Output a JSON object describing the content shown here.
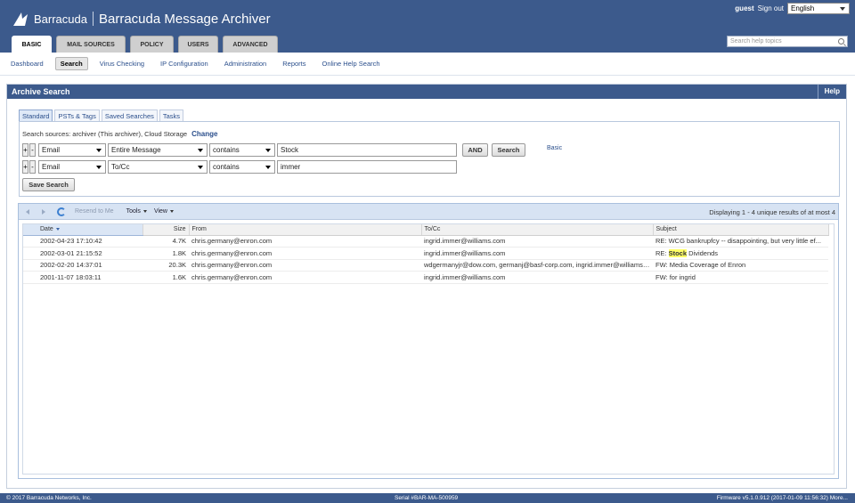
{
  "header": {
    "brand": "Barracuda",
    "app_title": "Barracuda Message Archiver",
    "username": "guest",
    "signout": "Sign out",
    "language": "English",
    "help_search_placeholder": "Search help topics",
    "tabs": [
      "BASIC",
      "MAIL SOURCES",
      "POLICY",
      "USERS",
      "ADVANCED"
    ]
  },
  "subnav": [
    "Dashboard",
    "Search",
    "Virus Checking",
    "IP Configuration",
    "Administration",
    "Reports",
    "Online Help Search"
  ],
  "panel": {
    "title": "Archive Search",
    "help": "Help",
    "search_tabs": [
      "Standard",
      "PSTs & Tags",
      "Saved Searches",
      "Tasks"
    ],
    "sources_text": "Search sources: archiver (This archiver), Cloud Storage",
    "change_link": "Change",
    "criteria": [
      {
        "field": "Email",
        "scope": "Entire Message",
        "op": "contains",
        "value": "Stock"
      },
      {
        "field": "Email",
        "scope": "To/Cc",
        "op": "contains",
        "value": "immer"
      }
    ],
    "and_label": "AND",
    "search_label": "Search",
    "basic_link": "Basic",
    "save_search_label": "Save Search",
    "plus": "+",
    "minus": "-"
  },
  "grid": {
    "toolbar": {
      "resend": "Resend to Me",
      "tools": "Tools",
      "view": "View",
      "display_count": "Displaying 1 - 4 unique results of at most 4"
    },
    "columns": [
      "Date",
      "Size",
      "From",
      "To/Cc",
      "Subject"
    ],
    "rows": [
      {
        "date": "2002-04-23 17:10:42",
        "size": "4.7K",
        "from": "chris.germany@enron.com",
        "to": "ingrid.immer@williams.com",
        "subject_pre": "RE: WCG bankrupfcy -- disappointing, but very little ef...",
        "subject_hl": "",
        "subject_post": ""
      },
      {
        "date": "2002-03-01 21:15:52",
        "size": "1.8K",
        "from": "chris.germany@enron.com",
        "to": "ingrid.immer@williams.com",
        "subject_pre": "RE: ",
        "subject_hl": "Stock",
        "subject_post": " Dividends"
      },
      {
        "date": "2002-02-20 14:37:01",
        "size": "20.3K",
        "from": "chris.germany@enron.com",
        "to": "wdgermanyjr@dow.com, germanj@basf-corp.com, ingrid.immer@williams....",
        "subject_pre": "FW: Media Coverage of Enron",
        "subject_hl": "",
        "subject_post": ""
      },
      {
        "date": "2001-11-07 18:03:11",
        "size": "1.6K",
        "from": "chris.germany@enron.com",
        "to": "ingrid.immer@williams.com",
        "subject_pre": "FW: for ingrid",
        "subject_hl": "",
        "subject_post": ""
      }
    ]
  },
  "footer": {
    "copyright": "© 2017 Barracuda Networks, Inc.",
    "serial": "Serial #BAR-MA-500959",
    "firmware": "Firmware v5.1.0.912 (2017-01-09 11:56:32) More..."
  },
  "colors": {
    "header_bg": "#3c5a8c",
    "link": "#2b4f8c",
    "highlight": "#ffff66"
  }
}
